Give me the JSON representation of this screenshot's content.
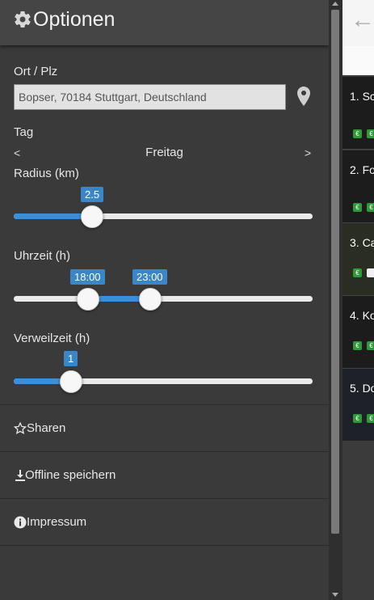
{
  "panel": {
    "title": "Optionen",
    "location": {
      "label": "Ort / Plz",
      "value": "Bopser, 70184 Stuttgart, Deutschland"
    },
    "day": {
      "label": "Tag",
      "prev": "<",
      "value": "Freitag",
      "next": ">"
    },
    "radius": {
      "label": "Radius (km)",
      "value": "2.5",
      "level": 0.26
    },
    "time": {
      "label": "Uhrzeit (h)",
      "from": "18:00",
      "to": "23:00",
      "from_level": 0.25,
      "to_level": 0.46
    },
    "stay": {
      "label": "Verweilzeit (h)",
      "value": "1",
      "level": 0.19
    },
    "menu": [
      {
        "label": "Sharen",
        "icon": "star-icon"
      },
      {
        "label": "Offline speichern",
        "icon": "download-icon"
      },
      {
        "label": "Impressum",
        "icon": "info-icon"
      }
    ]
  },
  "content": {
    "cards": [
      {
        "num": "1. Sc"
      },
      {
        "num": "2. Fo"
      },
      {
        "num": "3. Ca"
      },
      {
        "num": "4. Ko"
      },
      {
        "num": "5. Do"
      }
    ],
    "chip": "€"
  },
  "colors": {
    "accent": "#3a8fd8",
    "panel_bg": "#3a3a3a",
    "header_bg": "#454545",
    "chip_green": "#2f9a3a"
  }
}
